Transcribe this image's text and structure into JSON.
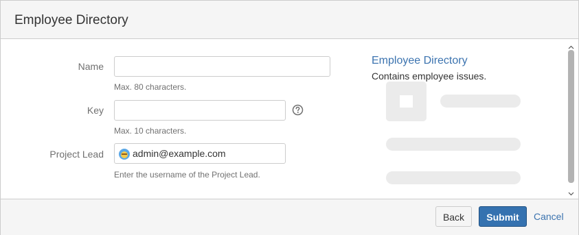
{
  "dialog": {
    "title": "Employee Directory"
  },
  "form": {
    "name": {
      "label": "Name",
      "value": "",
      "description": "Max. 80 characters."
    },
    "key": {
      "label": "Key",
      "value": "",
      "description": "Max. 10 characters.",
      "help_icon": "question-circle-icon"
    },
    "project_lead": {
      "label": "Project Lead",
      "value": "admin@example.com",
      "description": "Enter the username of the Project Lead.",
      "avatar_icon": "user-avatar-icon"
    }
  },
  "preview": {
    "title": "Employee Directory",
    "description": "Contains employee issues."
  },
  "footer": {
    "back_label": "Back",
    "submit_label": "Submit",
    "cancel_label": "Cancel"
  },
  "colors": {
    "accent": "#3572b0",
    "link": "#3b73af",
    "header_bg": "#f5f5f5",
    "placeholder": "#ebebeb"
  }
}
